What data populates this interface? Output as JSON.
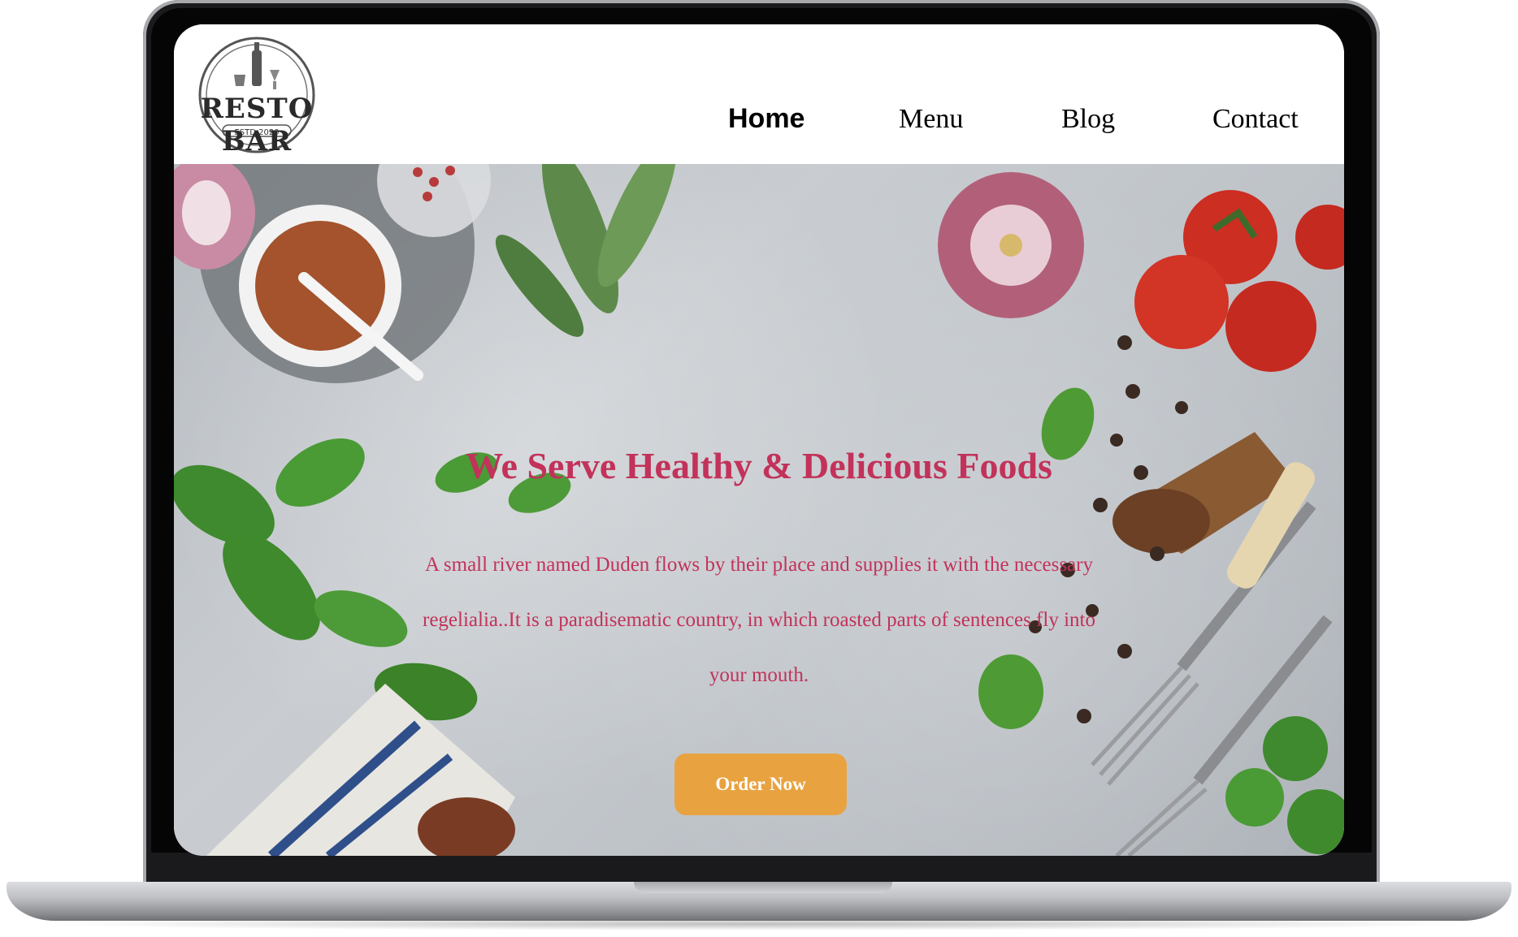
{
  "brand": {
    "name": "RESTO BAR",
    "established": "ESTD 2020"
  },
  "nav": {
    "items": [
      {
        "label": "Home",
        "active": true
      },
      {
        "label": "Menu",
        "active": false
      },
      {
        "label": "Blog",
        "active": false
      },
      {
        "label": "Contact",
        "active": false
      }
    ]
  },
  "hero": {
    "title": "We Serve Healthy & Delicious Foods",
    "description": "A small river named Duden flows by their place and supplies it with the necessary regelialia..It is a paradisematic country, in which roasted parts of sentences fly into your mouth.",
    "cta_label": "Order Now"
  },
  "colors": {
    "accent_text": "#c2325a",
    "cta_background": "#e8a340",
    "nav_text": "#000000"
  },
  "icons": [
    "resto-bar-logo",
    "garlic",
    "tomato",
    "basil-leaf",
    "spice-bowl",
    "fork"
  ]
}
